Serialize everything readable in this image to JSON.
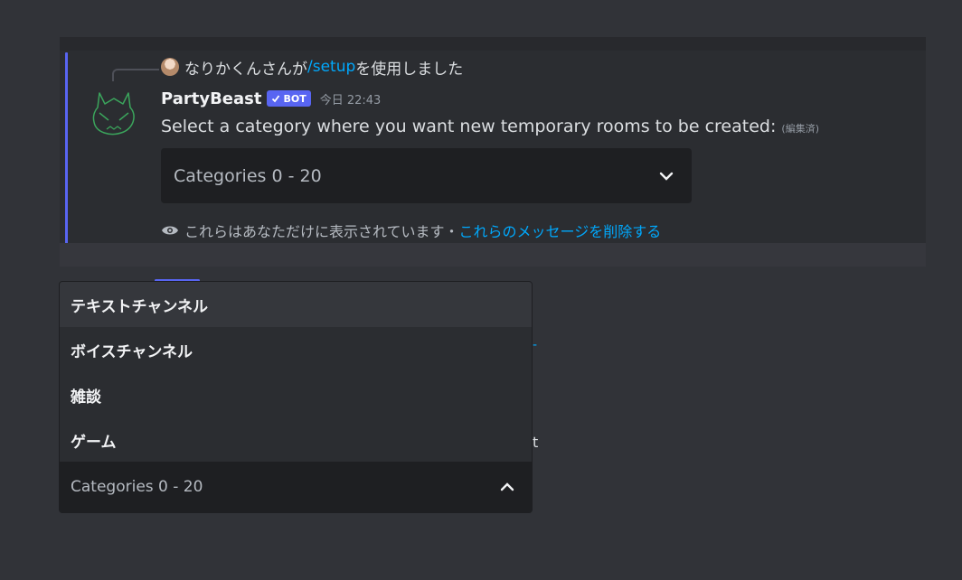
{
  "reply": {
    "user_text": "なりかくんさんが",
    "command": "/setup",
    "suffix": "を使用しました"
  },
  "message": {
    "author": "PartyBeast",
    "badge": "BOT",
    "timestamp": "今日 22:43",
    "content": "Select a category where you want new temporary rooms to be created:",
    "edited": "(編集済)"
  },
  "select": {
    "placeholder": "Categories 0 - 20"
  },
  "ephemeral": {
    "notice": "これらはあなただけに表示されています・",
    "delete_link": "これらのメッセージを削除する"
  },
  "dropdown": {
    "options": [
      "テキストチャンネル",
      "ボイスチャンネル",
      "雑談",
      "ゲーム"
    ],
    "placeholder": "Categories 0 - 20"
  },
  "colors": {
    "background": "#313338",
    "accent": "#5865f2",
    "link": "#00a8fc",
    "bot_avatar": "#3ba55c"
  },
  "icons": {
    "chevron_down": "chevron-down-icon",
    "chevron_up": "chevron-up-icon",
    "eye": "eye-icon",
    "check": "check-icon"
  }
}
